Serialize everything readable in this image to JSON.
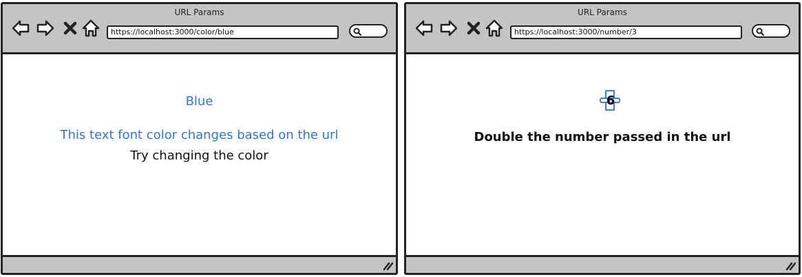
{
  "left_window": {
    "title": "URL Params",
    "url": "https://localhost:3000/color/blue",
    "content": {
      "color_name": "Blue",
      "line1": "This text font color changes based on the url",
      "line2": "Try changing the color"
    },
    "accent_color": "#2f77d1"
  },
  "right_window": {
    "title": "URL Params",
    "url": "https://localhost:3000/number/3",
    "content": {
      "number": "6",
      "caption": "Double the number passed in the url"
    }
  },
  "icons": [
    "back-arrow-icon",
    "forward-arrow-icon",
    "close-icon",
    "home-icon",
    "search-icon",
    "resize-grip-icon"
  ]
}
